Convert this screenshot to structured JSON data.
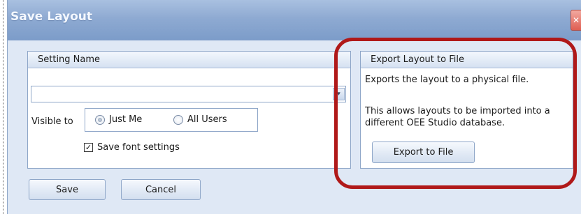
{
  "window": {
    "title": "Save Layout",
    "close_glyph": "✕"
  },
  "settings": {
    "header": "Setting Name",
    "setting_name_value": "",
    "dropdown_glyph": "▾",
    "visible_to_label": "Visible to",
    "radios": [
      {
        "label": "Just Me",
        "checked": true
      },
      {
        "label": "All Users",
        "checked": false
      }
    ],
    "save_font_label": "Save font settings",
    "save_font_checked": true,
    "check_glyph": "✓"
  },
  "export": {
    "header": "Export Layout to File",
    "desc1": "Exports the layout to a physical file.",
    "desc2": "This allows layouts to be imported into a different OEE Studio database.",
    "button_label": "Export to File"
  },
  "footer": {
    "save_label": "Save",
    "cancel_label": "Cancel"
  },
  "colors": {
    "titlebar": "#8eaad2",
    "body": "#dfe8f5",
    "highlight": "#b01919"
  }
}
